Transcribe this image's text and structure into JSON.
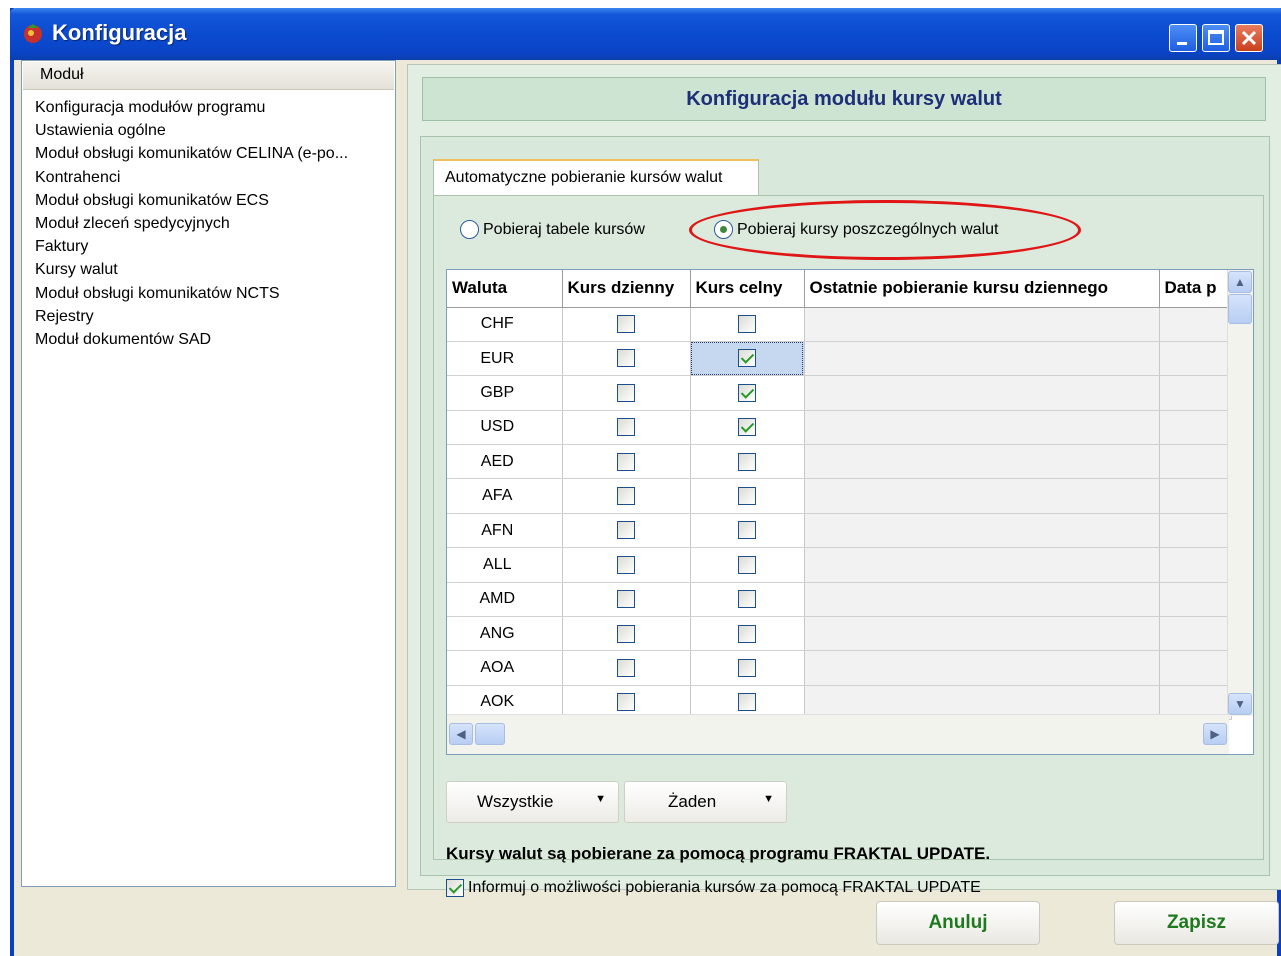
{
  "window": {
    "title": "Konfiguracja"
  },
  "left": {
    "header": "Moduł",
    "items": [
      "Konfiguracja modułów programu",
      "Ustawienia ogólne",
      "Moduł obsługi komunikatów CELINA (e-po...",
      "Kontrahenci",
      "Moduł obsługi komunikatów ECS",
      "Moduł zleceń spedycyjnych",
      "Faktury",
      "Kursy walut",
      "Moduł obsługi komunikatów NCTS",
      "Rejestry",
      "Moduł dokumentów SAD"
    ]
  },
  "main": {
    "title": "Konfiguracja modułu kursy walut",
    "tab": "Automatyczne pobieranie kursów walut",
    "radio1": "Pobieraj tabele kursów",
    "radio2": "Pobieraj kursy poszczególnych walut",
    "columns": [
      "Waluta",
      "Kurs dzienny",
      "Kurs celny",
      "Ostatnie pobieranie kursu dziennego",
      "Data p"
    ],
    "rows": [
      {
        "currency": "CHF",
        "daily": false,
        "customs": false
      },
      {
        "currency": "EUR",
        "daily": false,
        "customs": true
      },
      {
        "currency": "GBP",
        "daily": false,
        "customs": true
      },
      {
        "currency": "USD",
        "daily": false,
        "customs": true
      },
      {
        "currency": "AED",
        "daily": false,
        "customs": false
      },
      {
        "currency": "AFA",
        "daily": false,
        "customs": false
      },
      {
        "currency": "AFN",
        "daily": false,
        "customs": false
      },
      {
        "currency": "ALL",
        "daily": false,
        "customs": false
      },
      {
        "currency": "AMD",
        "daily": false,
        "customs": false
      },
      {
        "currency": "ANG",
        "daily": false,
        "customs": false
      },
      {
        "currency": "AOA",
        "daily": false,
        "customs": false
      },
      {
        "currency": "AOK",
        "daily": false,
        "customs": false
      }
    ],
    "btn_all": "Wszystkie",
    "btn_none": "Żaden",
    "info_text": "Kursy walut są pobierane za pomocą programu FRAKTAL UPDATE.",
    "info_checkbox": "Informuj o możliwości pobierania kursów za pomocą FRAKTAL UPDATE"
  },
  "footer": {
    "cancel": "Anuluj",
    "save": "Zapisz"
  },
  "colors": {
    "titlebar": "#0a44c6",
    "panel": "#e3eee3",
    "highlight": "#e01515",
    "accent_text": "#1f7a1f"
  }
}
